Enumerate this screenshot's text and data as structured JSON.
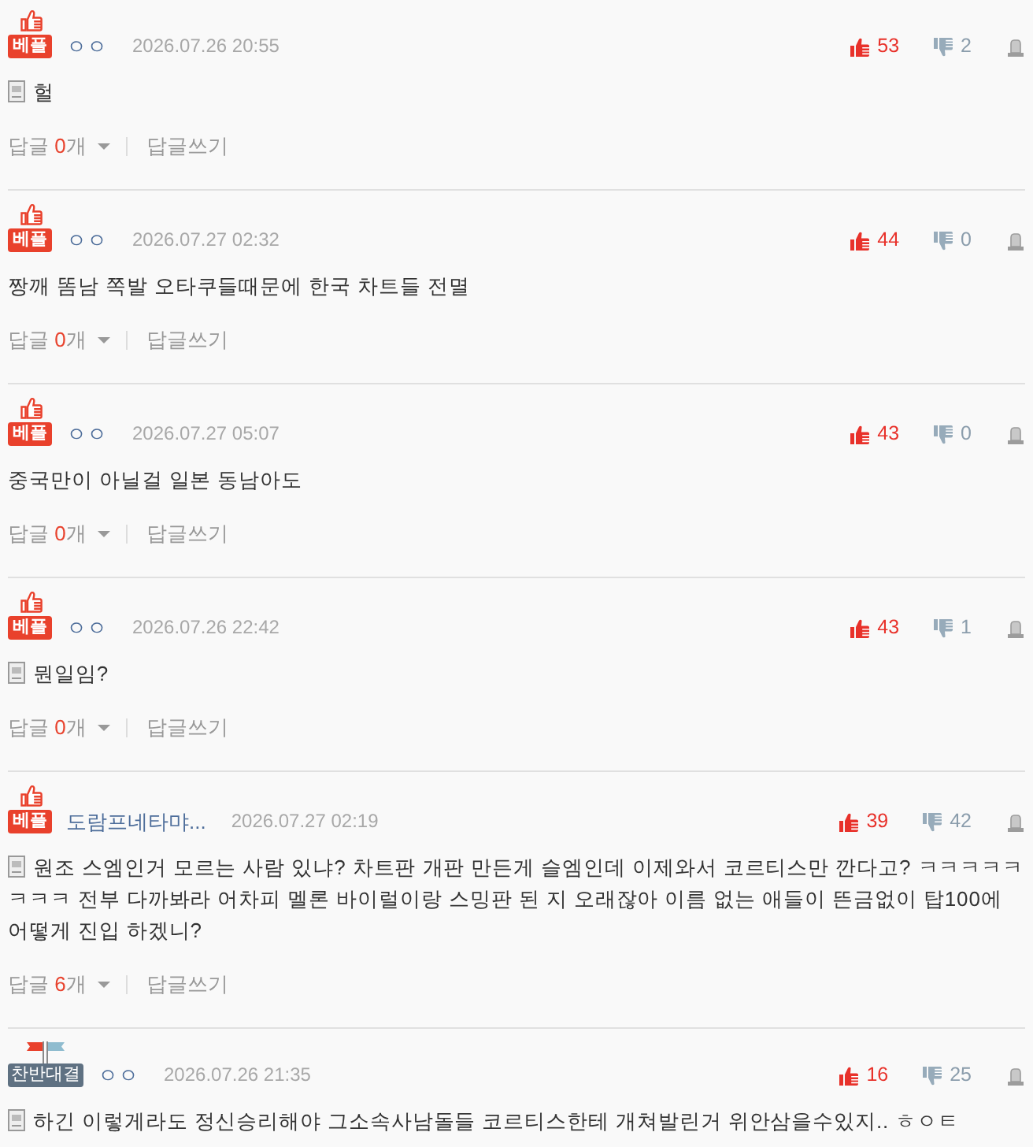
{
  "comments": [
    {
      "badge": {
        "kind": "best",
        "label": "베플"
      },
      "author": "ㅇㅇ",
      "date": "2026.07.26 20:55",
      "up": "53",
      "down": "2",
      "note_icon": true,
      "text": "헐",
      "replies": {
        "label": "답글",
        "count": "0",
        "unit": "개",
        "write": "답글쓰기"
      }
    },
    {
      "badge": {
        "kind": "best",
        "label": "베플"
      },
      "author": "ㅇㅇ",
      "date": "2026.07.27 02:32",
      "up": "44",
      "down": "0",
      "note_icon": false,
      "text": "짱깨 똠남 쪽발 오타쿠들때문에 한국 차트들 전멸",
      "replies": {
        "label": "답글",
        "count": "0",
        "unit": "개",
        "write": "답글쓰기"
      }
    },
    {
      "badge": {
        "kind": "best",
        "label": "베플"
      },
      "author": "ㅇㅇ",
      "date": "2026.07.27 05:07",
      "up": "43",
      "down": "0",
      "note_icon": false,
      "text": "중국만이 아닐걸 일본 동남아도",
      "replies": {
        "label": "답글",
        "count": "0",
        "unit": "개",
        "write": "답글쓰기"
      }
    },
    {
      "badge": {
        "kind": "best",
        "label": "베플"
      },
      "author": "ㅇㅇ",
      "date": "2026.07.26 22:42",
      "up": "43",
      "down": "1",
      "note_icon": true,
      "text": "뭔일임?",
      "replies": {
        "label": "답글",
        "count": "0",
        "unit": "개",
        "write": "답글쓰기"
      }
    },
    {
      "badge": {
        "kind": "best",
        "label": "베플"
      },
      "author": "도람프네타먀...",
      "date": "2026.07.27 02:19",
      "up": "39",
      "down": "42",
      "note_icon": true,
      "text": "원조 스엠인거 모르는 사람 있냐? 차트판 개판 만든게 슬엠인데 이제와서 코르티스만 깐다고? ㅋㅋㅋㅋㅋㅋㅋㅋ 전부 다까봐라 어차피 멜론 바이럴이랑 스밍판 된 지 오래잖아 이름 없는 애들이 뜬금없이 탑100에 어떻게 진입 하겠니?",
      "replies": {
        "label": "답글",
        "count": "6",
        "unit": "개",
        "write": "답글쓰기"
      }
    },
    {
      "badge": {
        "kind": "versus",
        "label": "찬반대결"
      },
      "author": "ㅇㅇ",
      "date": "2026.07.26 21:35",
      "up": "16",
      "down": "25",
      "note_icon": true,
      "text": "하긴 이렇게라도 정신승리해야 그소속사남돌들 코르티스한테 개쳐발린거 위안삼을수있지.. ㅎㅇㅌ"
    }
  ]
}
